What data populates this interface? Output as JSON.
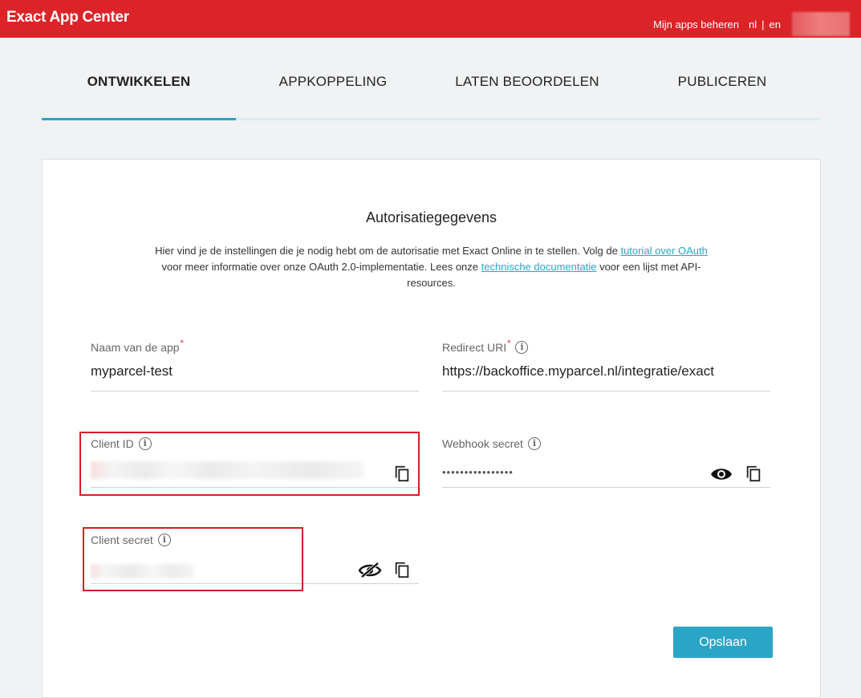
{
  "header": {
    "title": "Exact App Center",
    "manage_apps": "Mijn apps beheren",
    "lang_nl": "nl",
    "lang_sep": "|",
    "lang_en": "en"
  },
  "steps": [
    {
      "label": "ONTWIKKELEN",
      "active": true
    },
    {
      "label": "APPKOPPELING",
      "active": false
    },
    {
      "label": "LATEN BEOORDELEN",
      "active": false
    },
    {
      "label": "PUBLICEREN",
      "active": false
    }
  ],
  "card": {
    "title": "Autorisatiegegevens",
    "intro_1": "Hier vind je de instellingen die je nodig hebt om de autorisatie met Exact Online in te stellen. Volg de ",
    "intro_link_1": "tutorial over OAuth",
    "intro_2": " voor meer informatie over onze OAuth 2.0-implementatie. Lees onze ",
    "intro_link_2": "technische documentatie",
    "intro_3": " voor een lijst met API-resources."
  },
  "fields": {
    "app_name": {
      "label": "Naam van de app",
      "required": "*",
      "value": "myparcel-test"
    },
    "redirect_uri": {
      "label": "Redirect URI",
      "required": "*",
      "value": "https://backoffice.myparcel.nl/integratie/exact"
    },
    "client_id": {
      "label": "Client ID"
    },
    "webhook_secret": {
      "label": "Webhook secret",
      "value": "••••••••••••••••"
    },
    "client_secret": {
      "label": "Client secret"
    }
  },
  "actions": {
    "save": "Opslaan"
  },
  "colors": {
    "brand": "#dc2328",
    "accent": "#2ba5c6",
    "highlight": "#d81c22"
  },
  "icons": {
    "info": "info-icon",
    "copy": "copy-icon",
    "eye": "eye-icon",
    "eye_off": "eye-off-icon"
  }
}
